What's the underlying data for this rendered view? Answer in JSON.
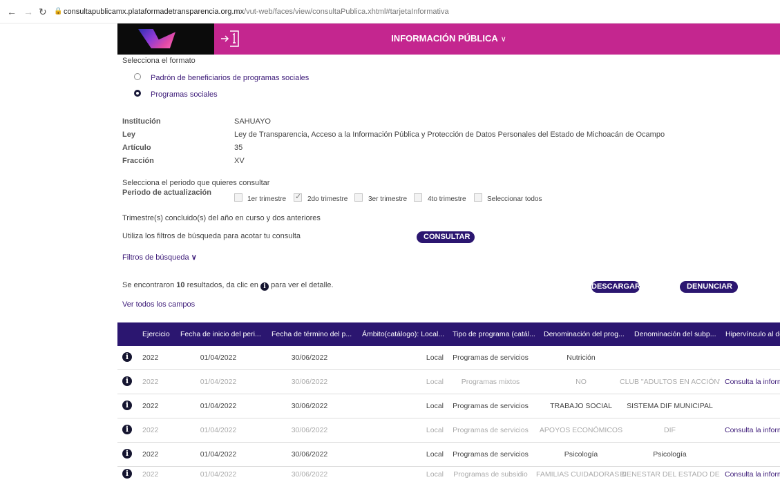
{
  "browser": {
    "url_host": "consultapublicamx.plataformadetransparencia.org.mx",
    "url_path": "/vut-web/faces/view/consultaPublica.xhtml#tarjetaInformativa"
  },
  "header": {
    "title": "INFORMACIÓN PÚBLICA"
  },
  "format": {
    "prompt": "Selecciona el formato",
    "options": [
      {
        "label": "Padrón de beneficiarios de programas sociales",
        "selected": false
      },
      {
        "label": "Programas sociales",
        "selected": true
      }
    ]
  },
  "details": [
    {
      "label": "Institución",
      "value": "SAHUAYO"
    },
    {
      "label": "Ley",
      "value": "Ley de Transparencia, Acceso a la Información Pública y Protección de Datos Personales del Estado de Michoacán de Ocampo"
    },
    {
      "label": "Artículo",
      "value": "35"
    },
    {
      "label": "Fracción",
      "value": "XV"
    }
  ],
  "period": {
    "prompt": "Selecciona el periodo que quieres consultar",
    "label": "Periodo de actualización",
    "options": [
      {
        "label": "1er trimestre",
        "checked": false
      },
      {
        "label": "2do trimestre",
        "checked": true
      },
      {
        "label": "3er trimestre",
        "checked": false
      },
      {
        "label": "4to trimestre",
        "checked": false
      },
      {
        "label": "Seleccionar todos",
        "checked": false
      }
    ],
    "note": "Trimestre(s) concluido(s) del año en curso y dos anteriores"
  },
  "filters": {
    "hint": "Utiliza los filtros de búsqueda para acotar tu consulta",
    "consult_label": "CONSULTAR",
    "toggle_label": "Filtros de búsqueda"
  },
  "results": {
    "prefix": "Se encontraron",
    "count": "10",
    "suffix": "resultados, da clic en",
    "suffix2": "para ver el detalle.",
    "download_label": "DESCARGAR",
    "report_label": "DENUNCIAR",
    "all_fields_label": "Ver todos los campos"
  },
  "table": {
    "columns": [
      "Ejercicio",
      "Fecha de inicio del peri...",
      "Fecha de término del p...",
      "Ámbito(catálogo): Local...",
      "Tipo de programa (catál...",
      "Denominación del prog...",
      "Denominación del subp...",
      "Hipervínculo al do"
    ],
    "rows": [
      [
        "2022",
        "01/04/2022",
        "30/06/2022",
        "Local",
        "Programas de servicios",
        "Nutrición",
        "",
        ""
      ],
      [
        "2022",
        "01/04/2022",
        "30/06/2022",
        "Local",
        "Programas mixtos",
        "NO",
        "CLUB \"ADULTOS EN ACCIÓN\"",
        "Consulta la inform"
      ],
      [
        "2022",
        "01/04/2022",
        "30/06/2022",
        "Local",
        "Programas de servicios",
        "TRABAJO SOCIAL",
        "SISTEMA DIF MUNICIPAL",
        ""
      ],
      [
        "2022",
        "01/04/2022",
        "30/06/2022",
        "Local",
        "Programas de servicios",
        "APOYOS ECONÓMICOS",
        "DIF",
        "Consulta la inform"
      ],
      [
        "2022",
        "01/04/2022",
        "30/06/2022",
        "Local",
        "Programas de servicios",
        "Psicología",
        "Psicología",
        ""
      ],
      [
        "2022",
        "01/04/2022",
        "30/06/2022",
        "Local",
        "Programas de subsidio",
        "FAMILIAS CUIDADORAS DE",
        "BIENESTAR DEL ESTADO DE",
        "Consulta la inform"
      ]
    ]
  }
}
